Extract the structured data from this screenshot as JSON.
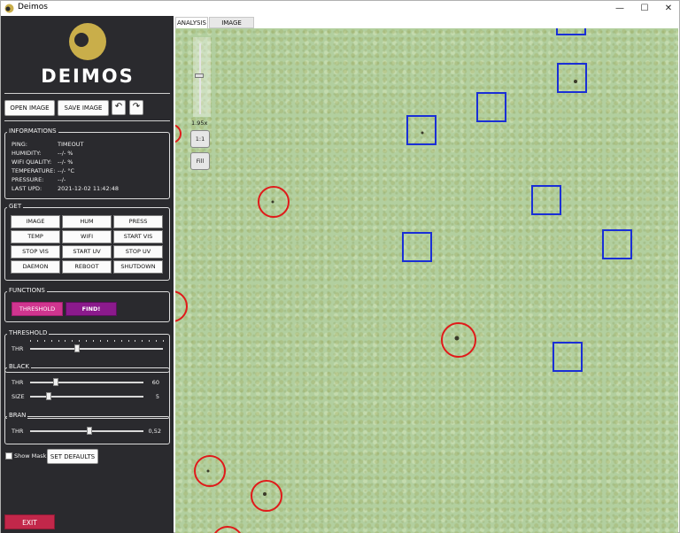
{
  "window": {
    "title": "Deimos",
    "minimize": "—",
    "maximize": "☐",
    "close": "✕"
  },
  "logo": {
    "text": "DEIMOS"
  },
  "toolbar": {
    "open_image": "OPEN IMAGE",
    "save_image": "SAVE IMAGE",
    "undo": "↶",
    "redo": "↷"
  },
  "informations": {
    "title": "INFORMATIONS",
    "rows": [
      {
        "label": "PING:",
        "value": "TIMEOUT"
      },
      {
        "label": "HUMIDITY:",
        "value": "--/- %"
      },
      {
        "label": "WIFI QUALITY:",
        "value": "--/- %"
      },
      {
        "label": "TEMPERATURE:",
        "value": "--/- °C"
      },
      {
        "label": "PRESSURE:",
        "value": "--/-"
      },
      {
        "label": "LAST UPD:",
        "value": "2021-12-02 11:42:48"
      }
    ]
  },
  "get": {
    "title": "GET",
    "buttons": [
      "IMAGE",
      "HUM",
      "PRESS",
      "TEMP",
      "WIFI",
      "START VIS",
      "STOP VIS",
      "START UV",
      "STOP UV",
      "DAEMON",
      "REBOOT",
      "SHUTDOWN"
    ]
  },
  "functions": {
    "title": "FUNCTIONS",
    "threshold": "THRESHOLD",
    "find": "FIND!",
    "threshold_color": "#d0358f",
    "find_color": "#8b1a8c"
  },
  "threshold": {
    "title": "THRESHOLD",
    "thr_label": "THR",
    "value": 0.35
  },
  "black": {
    "title": "BLACK",
    "thr_label": "THR",
    "thr_value": "60",
    "size_label": "SIZE",
    "size_value": "5"
  },
  "bran": {
    "title": "BRAN",
    "thr_label": "THR",
    "thr_value": "0,52"
  },
  "show_mask": {
    "label": "Show Mask",
    "checked": false
  },
  "set_defaults": "SET DEFAULTS",
  "exit": "EXIT",
  "tabs": [
    {
      "label": "ANALYSIS",
      "active": true
    },
    {
      "label": "IMAGE EDITOR",
      "active": false
    }
  ],
  "viewer": {
    "zoom": "1.95x",
    "one_to_one": "1:1",
    "fill": "Fill"
  },
  "colors": {
    "sidebar": "#2a2a2e",
    "accent_gold": "#c9ae4a",
    "exit": "#c2274a",
    "marker_square": "#1a2fd6",
    "marker_circle": "#e01a1a",
    "image_bg": "#b2cf9f"
  }
}
